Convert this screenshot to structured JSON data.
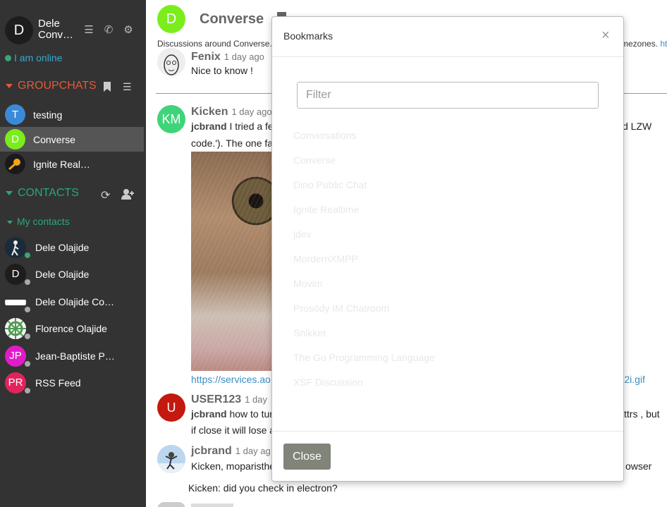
{
  "profile": {
    "avatar_letter": "D",
    "name_line1": "Dele",
    "name_line2": "Conv…",
    "status_text": "I am online"
  },
  "groupchats": {
    "heading": "GROUPCHATS",
    "rooms": [
      {
        "letter": "T",
        "label": "testing",
        "color": "#3b8ad8"
      },
      {
        "letter": "D",
        "label": "Converse",
        "color": "#7bed1c",
        "active": true
      },
      {
        "letter": "",
        "label": "Ignite Real…",
        "color": "#222222"
      }
    ]
  },
  "contacts": {
    "heading": "CONTACTS",
    "group_label": "My contacts",
    "items": [
      {
        "letter": "",
        "label": "Dele Olajide",
        "avatar_color": "#1a2b3a",
        "status_color": "#3aa57a"
      },
      {
        "letter": "D",
        "label": "Dele Olajide",
        "avatar_color": "#1d1d1d",
        "status_color": "#aaaaaa"
      },
      {
        "letter": "",
        "label": "Dele Olajide Co…",
        "avatar_color": "#ffffff",
        "status_color": "#aaaaaa"
      },
      {
        "letter": "",
        "label": "Florence Olajide",
        "avatar_color": "#5aa05a",
        "status_color": "#aaaaaa"
      },
      {
        "letter": "JP",
        "label": "Jean-Baptiste P…",
        "avatar_color": "#e01cc9",
        "status_color": "#aaaaaa"
      },
      {
        "letter": "PR",
        "label": "RSS Feed",
        "avatar_color": "#e0245e",
        "status_color": "#aaaaaa"
      }
    ]
  },
  "chat": {
    "avatar_letter": "D",
    "title": "Converse",
    "description_left": "Discussions around Converse.",
    "description_right_text": "mezones.",
    "description_right_link": "ht",
    "messages": [
      {
        "author": "Fenix",
        "time": "1 day ago",
        "text": "Nice to know !"
      },
      {
        "author": "Kicken",
        "time": "1 day ago",
        "avatar_letter": "KM",
        "line1_mention": "jcbrand",
        "line1_text": " I tried a fe",
        "line1_right": "d LZW",
        "line2_text": "code.').  The one fa"
      },
      {
        "author": "USER123",
        "time": "1 day",
        "avatar_letter": "U",
        "line1_mention": "jcbrand",
        "line1_text": " how to tur",
        "line1_right": "ttrs , but",
        "line2_text": "if close it will lose a"
      },
      {
        "author": "jcbrand",
        "time": "1 day ag",
        "line1_text": "Kicken, moparisthe",
        "line1_right": "owser"
      },
      {
        "line1_text": "Kicken: did you check in electron?"
      }
    ],
    "link_left": "https://services.ao",
    "link_right": "B2i.gif"
  },
  "bookmarks_modal": {
    "title": "Bookmarks",
    "close_x": "×",
    "filter_placeholder": "Filter",
    "items": [
      "Conversations",
      "Converse",
      "Dino Public Chat",
      "Ignite Realtime",
      "jdev",
      "MordernXMPP",
      "Movim",
      "Prosōdy IM Chatroom",
      "Snikket",
      "The Go Programming Language",
      "XSF Discussion"
    ],
    "close_button": "Close"
  },
  "icons": {
    "profile_tools": [
      "list-icon",
      "phone-icon",
      "gear-icon"
    ],
    "groupchat_tools": [
      "bookmark-icon",
      "list-icon"
    ],
    "contact_tools": [
      "refresh-icon",
      "add-user-icon"
    ]
  }
}
